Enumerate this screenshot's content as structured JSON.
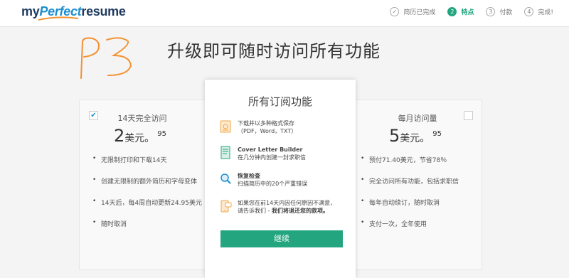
{
  "logo": {
    "my": "my",
    "perfect": "Perfect",
    "resume": "resume"
  },
  "steps": [
    {
      "number": "✓",
      "label": "简历已完成",
      "state": "done"
    },
    {
      "number": "2",
      "label": "特点",
      "state": "active"
    },
    {
      "number": "3",
      "label": "付款",
      "state": "pending"
    },
    {
      "number": "4",
      "label": "完成!",
      "state": "pending"
    }
  ],
  "heading": "升级即可随时访问所有功能",
  "left_plan": {
    "title": "14天完全访问",
    "price_big": "2",
    "price_unit": "美元。",
    "price_cents": "95",
    "features": [
      "无限制打印和下载14天",
      "创建无限制的额外简历和字母变体",
      "14天后，每4周自动更新24.95美元",
      "随时取消"
    ]
  },
  "middle": {
    "title": "所有订阅功能",
    "items": [
      {
        "icon": "document-formats-icon",
        "title": "下载并以多种格式保存",
        "desc": "（PDF，Word，TXT）"
      },
      {
        "icon": "cover-letter-icon",
        "title": "Cover Letter Builder",
        "desc": "在几分钟内创建一封求职信"
      },
      {
        "icon": "magnifier-icon",
        "title": "恢复检查",
        "desc": "扫描简历中的20个严重错误"
      },
      {
        "icon": "phone-support-icon",
        "line1": "如果您在前14天内因任何原因不满意，",
        "line2_prefix": "请告诉我们 - ",
        "line2_bold": "我们将退还您的款项。"
      }
    ],
    "button": "继续"
  },
  "right_plan": {
    "title": "每月访问量",
    "price_big": "5",
    "price_unit": "美元。",
    "price_cents": "95",
    "features": [
      "预付71.40美元，节省78％",
      "完全访问所有功能，包括求职信",
      "每年自动续订，随时取消",
      "支付一次，全年使用"
    ]
  },
  "colors": {
    "accent": "#23a57f",
    "brand": "#1b8fd0",
    "scribble": "#f39130"
  }
}
